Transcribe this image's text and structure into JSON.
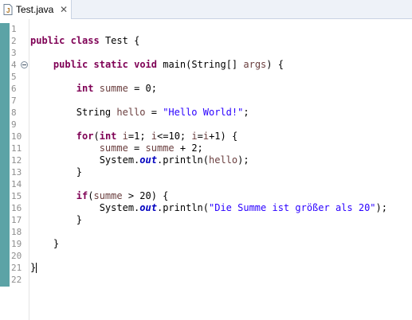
{
  "tab": {
    "title": "Test.java",
    "close": "✕",
    "icon": "java-file-icon"
  },
  "editor": {
    "lines": [
      {
        "n": "1",
        "t": ""
      },
      {
        "n": "2",
        "t": "public class Test {"
      },
      {
        "n": "3",
        "t": ""
      },
      {
        "n": "4",
        "t": "    public static void main(String[] args) {"
      },
      {
        "n": "5",
        "t": ""
      },
      {
        "n": "6",
        "t": "        int summe = 0;"
      },
      {
        "n": "7",
        "t": ""
      },
      {
        "n": "8",
        "t": "        String hello = \"Hello World!\";"
      },
      {
        "n": "9",
        "t": ""
      },
      {
        "n": "10",
        "t": "        for(int i=1; i<=10; i=i+1) {"
      },
      {
        "n": "11",
        "t": "            summe = summe + 2;"
      },
      {
        "n": "12",
        "t": "            System.out.println(hello);"
      },
      {
        "n": "13",
        "t": "        }"
      },
      {
        "n": "14",
        "t": ""
      },
      {
        "n": "15",
        "t": "        if(summe > 20) {"
      },
      {
        "n": "16",
        "t": "            System.out.println(\"Die Summe ist größer als 20\");"
      },
      {
        "n": "17",
        "t": "        }"
      },
      {
        "n": "18",
        "t": ""
      },
      {
        "n": "19",
        "t": "    }"
      },
      {
        "n": "20",
        "t": ""
      },
      {
        "n": "21",
        "t": "}"
      },
      {
        "n": "22",
        "t": ""
      }
    ]
  }
}
